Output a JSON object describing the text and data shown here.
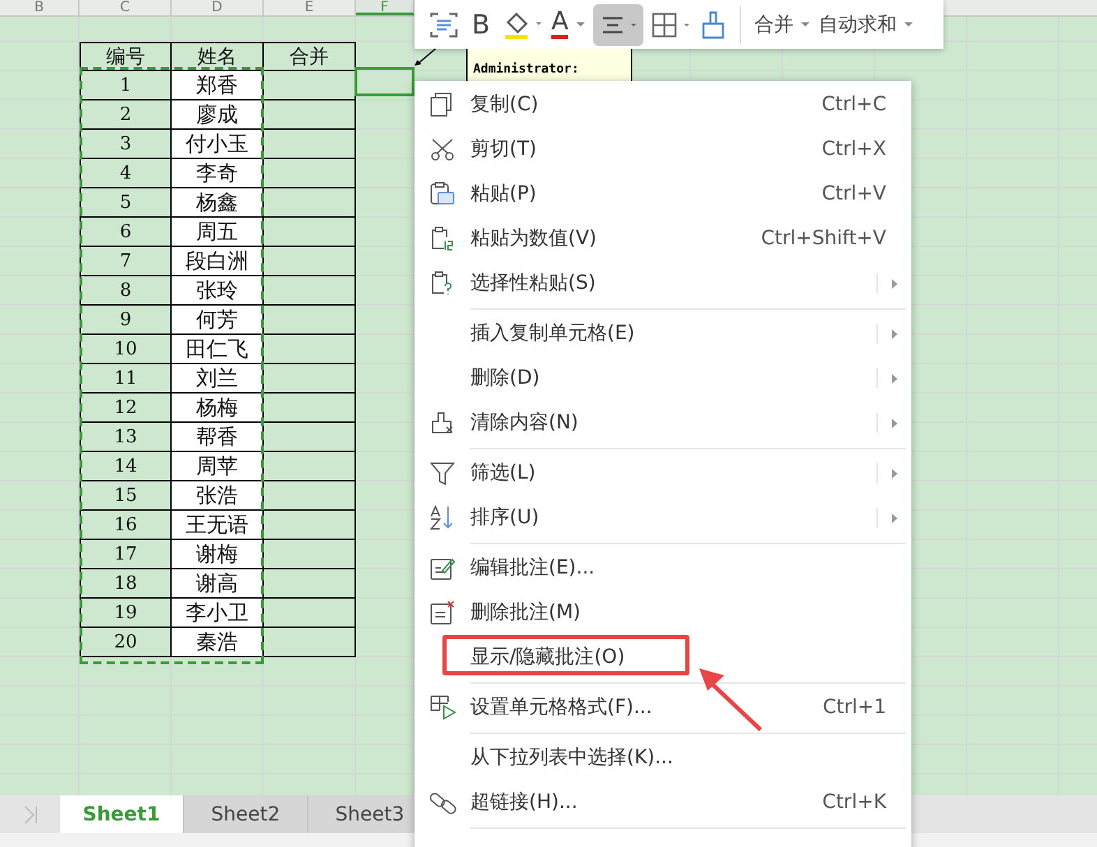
{
  "columns": [
    {
      "label": "B",
      "selected": false
    },
    {
      "label": "C",
      "selected": false
    },
    {
      "label": "D",
      "selected": false
    },
    {
      "label": "E",
      "selected": false
    },
    {
      "label": "F",
      "selected": true
    }
  ],
  "table": {
    "headers": [
      "编号",
      "姓名",
      "合并"
    ],
    "rows": [
      {
        "no": "1",
        "name": "郑香"
      },
      {
        "no": "2",
        "name": "廖成"
      },
      {
        "no": "3",
        "name": "付小玉"
      },
      {
        "no": "4",
        "name": "李奇"
      },
      {
        "no": "5",
        "name": "杨鑫"
      },
      {
        "no": "6",
        "name": "周五"
      },
      {
        "no": "7",
        "name": "段白洲"
      },
      {
        "no": "8",
        "name": "张玲"
      },
      {
        "no": "9",
        "name": "何芳"
      },
      {
        "no": "10",
        "name": "田仁飞"
      },
      {
        "no": "11",
        "name": "刘兰"
      },
      {
        "no": "12",
        "name": "杨梅"
      },
      {
        "no": "13",
        "name": "帮香"
      },
      {
        "no": "14",
        "name": "周苹"
      },
      {
        "no": "15",
        "name": "张浩"
      },
      {
        "no": "16",
        "name": "王无语"
      },
      {
        "no": "17",
        "name": "谢梅"
      },
      {
        "no": "18",
        "name": "谢高"
      },
      {
        "no": "19",
        "name": "李小卫"
      },
      {
        "no": "20",
        "name": "秦浩"
      }
    ]
  },
  "comment": {
    "author": "Administrator:"
  },
  "toolbar": {
    "bold": "B",
    "font_color": "A",
    "align_selected": true,
    "merge": "合并",
    "autosum": "自动求和"
  },
  "menu": {
    "items": [
      {
        "kind": "item",
        "label": "复制(C)",
        "shortcut": "Ctrl+C",
        "submenu": false,
        "highlighted": false
      },
      {
        "kind": "item",
        "label": "剪切(T)",
        "shortcut": "Ctrl+X",
        "submenu": false,
        "highlighted": false
      },
      {
        "kind": "item",
        "label": "粘贴(P)",
        "shortcut": "Ctrl+V",
        "submenu": false,
        "highlighted": false
      },
      {
        "kind": "item",
        "label": "粘贴为数值(V)",
        "shortcut": "Ctrl+Shift+V",
        "submenu": false,
        "highlighted": false
      },
      {
        "kind": "item",
        "label": "选择性粘贴(S)",
        "submenu": true,
        "highlighted": false
      },
      {
        "kind": "separator"
      },
      {
        "kind": "item",
        "label": "插入复制单元格(E)",
        "submenu": true,
        "highlighted": false
      },
      {
        "kind": "item",
        "label": "删除(D)",
        "submenu": true,
        "highlighted": false
      },
      {
        "kind": "item",
        "label": "清除内容(N)",
        "submenu": true,
        "highlighted": false
      },
      {
        "kind": "separator"
      },
      {
        "kind": "item",
        "label": "筛选(L)",
        "submenu": true,
        "highlighted": false
      },
      {
        "kind": "item",
        "label": "排序(U)",
        "submenu": true,
        "highlighted": false
      },
      {
        "kind": "separator"
      },
      {
        "kind": "item",
        "label": "编辑批注(E)...",
        "submenu": false,
        "highlighted": false
      },
      {
        "kind": "item",
        "label": "删除批注(M)",
        "submenu": false,
        "highlighted": false
      },
      {
        "kind": "item",
        "label": "显示/隐藏批注(O)",
        "submenu": false,
        "highlighted": true
      },
      {
        "kind": "separator"
      },
      {
        "kind": "item",
        "label": "设置单元格格式(F)...",
        "shortcut": "Ctrl+1",
        "submenu": false,
        "highlighted": false
      },
      {
        "kind": "separator"
      },
      {
        "kind": "item",
        "label": "从下拉列表中选择(K)...",
        "submenu": false,
        "highlighted": false
      },
      {
        "kind": "item",
        "label": "超链接(H)...",
        "shortcut": "Ctrl+K",
        "submenu": false,
        "highlighted": false
      },
      {
        "kind": "separator"
      }
    ]
  },
  "sheet_tabs": [
    {
      "label": "Sheet1",
      "selected": true
    },
    {
      "label": "Sheet2",
      "selected": false
    },
    {
      "label": "Sheet3",
      "selected": false
    }
  ]
}
